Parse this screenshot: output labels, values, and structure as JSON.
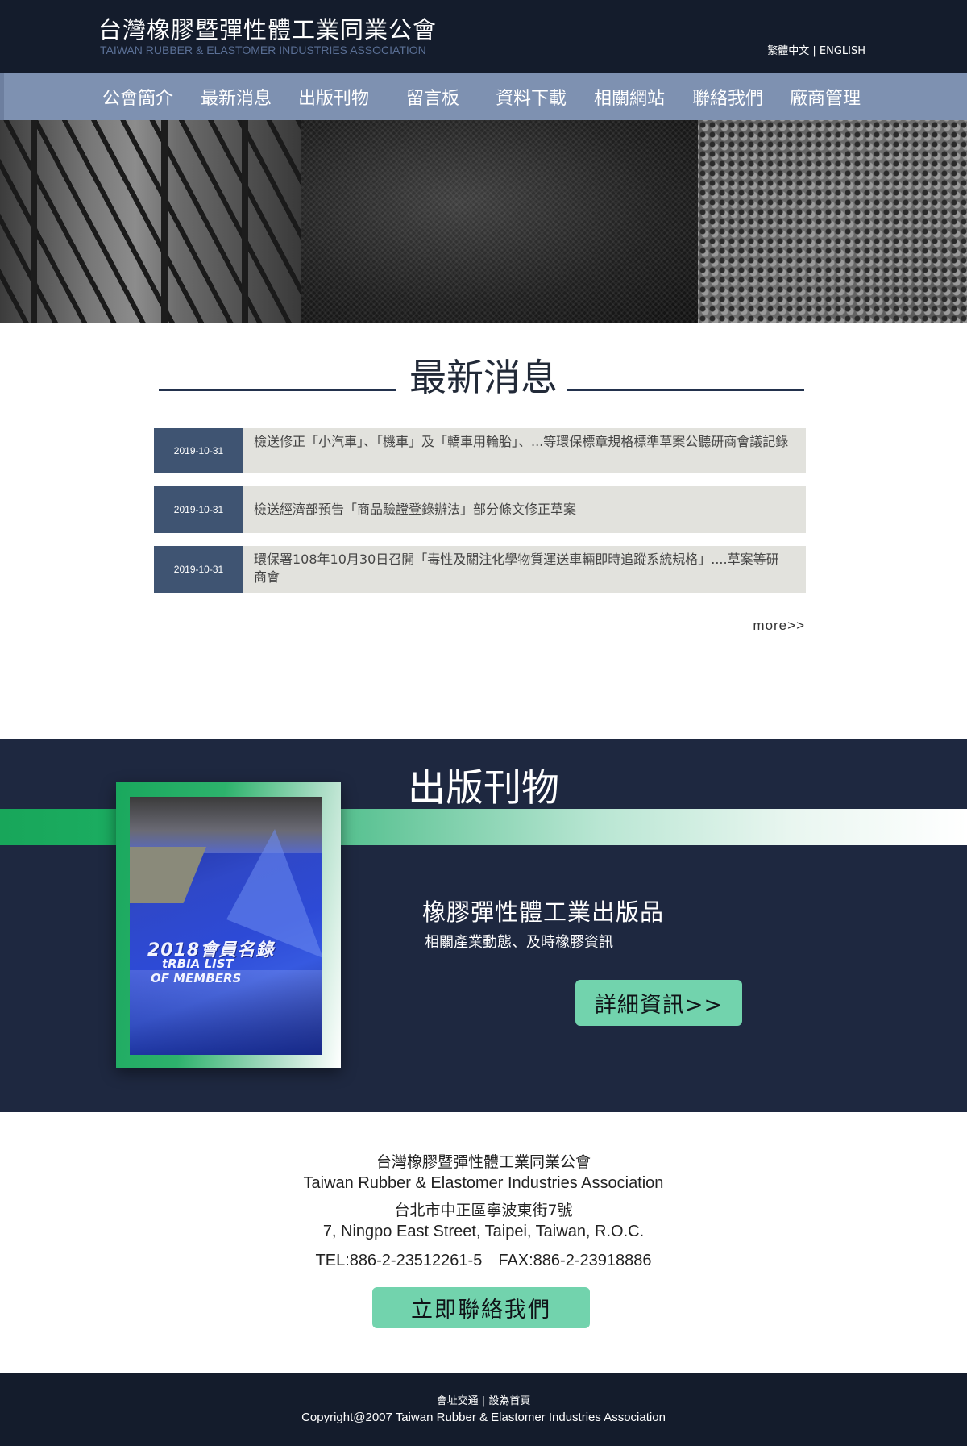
{
  "header": {
    "title": "台灣橡膠暨彈性體工業同業公會",
    "subtitle": "TAIWAN RUBBER & ELASTOMER INDUSTRIES ASSOCIATION",
    "lang_zh": "繁體中文",
    "lang_sep": "|",
    "lang_en": "ENGLISH"
  },
  "nav": {
    "items": [
      {
        "label": "公會簡介"
      },
      {
        "label": "最新消息"
      },
      {
        "label": "出版刊物"
      },
      {
        "label": "留言板"
      },
      {
        "label": "資料下載"
      },
      {
        "label": "相關網站"
      },
      {
        "label": "聯絡我們"
      },
      {
        "label": "廠商管理"
      }
    ]
  },
  "news": {
    "title": "最新消息",
    "items": [
      {
        "date": "2019-10-31",
        "text": "檢送修正「小汽車」、「機車」及「轎車用輪胎」、...等環保標章規格標準草案公聽研商會議記錄"
      },
      {
        "date": "2019-10-31",
        "text": "檢送經濟部預告「商品驗證登錄辦法」部分條文修正草案"
      },
      {
        "date": "2019-10-31",
        "text": "環保署108年10月30日召開「毒性及關注化學物質運送車輛即時追蹤系統規格」....草案等研商會"
      }
    ],
    "more": "more>>"
  },
  "publications": {
    "title": "出版刊物",
    "heading": "橡膠彈性體工業出版品",
    "description": "相關產業動態、及時橡膠資訊",
    "detail_button": "詳細資訊>>",
    "cover": {
      "line1": "2018會員名錄",
      "line2": "tRBIA LIST",
      "line3": "OF MEMBERS"
    }
  },
  "footer": {
    "name_zh": "台灣橡膠暨彈性體工業同業公會",
    "name_en": "Taiwan Rubber & Elastomer Industries Association",
    "address_zh": "台北市中正區寧波東街7號",
    "address_en": "7, Ningpo East Street, Taipei, Taiwan, R.O.C.",
    "phone_fax": "TEL:886-2-23512261-5　FAX:886-2-23918886",
    "contact_button": "立即聯絡我們",
    "link_traffic": "會址交通",
    "link_sep": "|",
    "link_home": "設為首頁",
    "copyright": "Copyright@2007 Taiwan Rubber & Elastomer Industries Association"
  },
  "colors": {
    "header_bg": "#141c2c",
    "nav_bg": "#7e91b1",
    "date_bg": "#3f5472",
    "news_bg": "#e2e2dd",
    "pub_bg": "#1e2840",
    "accent_green": "#72d3ad",
    "band_green": "#18a65a"
  }
}
